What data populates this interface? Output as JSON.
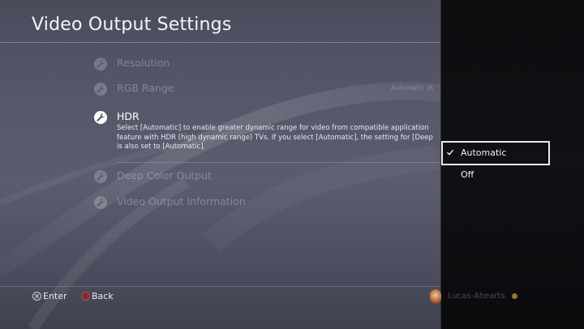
{
  "page": {
    "title": "Video Output Settings"
  },
  "menu": {
    "items": [
      {
        "id": "resolution",
        "label": "Resolution",
        "value": "",
        "icon": "wrench-icon",
        "selected": false
      },
      {
        "id": "rgb-range",
        "label": "RGB Range",
        "value": "Automatic (R",
        "icon": "wrench-icon",
        "selected": false
      },
      {
        "id": "hdr",
        "label": "HDR",
        "value": "",
        "icon": "wrench-icon",
        "selected": true,
        "description": "Select [Automatic] to enable greater dynamic range for video from compatible application\nfeature with HDR (high dynamic range) TVs. If you select [Automatic], the setting for [Deep\nis also set to [Automatic]."
      },
      {
        "id": "deep-color-output",
        "label": "Deep Color Output",
        "value": "",
        "icon": "wrench-icon",
        "selected": false
      },
      {
        "id": "video-output-information",
        "label": "Video Output Information",
        "value": "",
        "icon": "wrench-icon",
        "selected": false
      }
    ]
  },
  "footer": {
    "enter_label": "Enter",
    "enter_icon": "cross-button-icon",
    "back_label": "Back",
    "back_icon": "circle-button-icon"
  },
  "options_panel": {
    "options": [
      {
        "label": "Automatic",
        "checked": true,
        "focused": true
      },
      {
        "label": "Off",
        "checked": false,
        "focused": false
      }
    ]
  },
  "user": {
    "name": "Lucas-Ahearts",
    "status_color": "#8a7a2a"
  },
  "colors": {
    "background": "#56586a",
    "panel": "#0f0f12",
    "focus_border": "#e9e9ee",
    "circle_button": "#7a2f36"
  }
}
